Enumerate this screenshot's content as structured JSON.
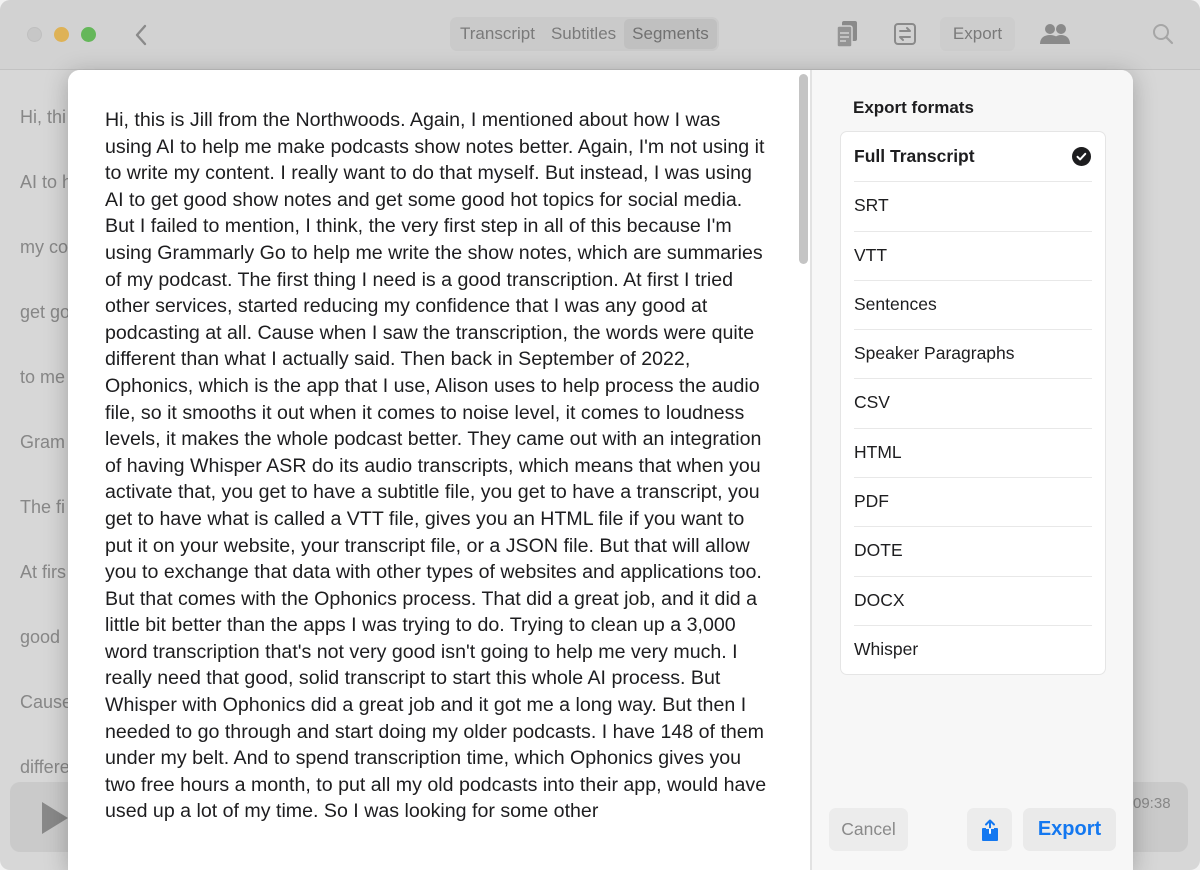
{
  "toolbar": {
    "tabs": [
      {
        "label": "Transcript",
        "active": false
      },
      {
        "label": "Subtitles",
        "active": false
      },
      {
        "label": "Segments",
        "active": true
      }
    ],
    "export_label": "Export",
    "icons": [
      "chevron-left-icon",
      "copy-icon",
      "convert-icon",
      "people-icon",
      "search-icon"
    ]
  },
  "background": {
    "lines": [
      "Hi, thi",
      "AI to h",
      "my co",
      "get go",
      "to me",
      "Gram",
      "The fi",
      "At firs",
      "good",
      "Cause",
      "differe"
    ],
    "time_fragment": "09:38"
  },
  "transcript": {
    "text": "Hi, this is Jill from the Northwoods. Again, I mentioned about how I was using AI to help me make podcasts show notes better. Again, I'm not using it to write my content. I really want to do that myself. But instead, I was using AI to get good show notes and get some good hot topics for social media. But I failed to mention, I think, the very first step in all of this because I'm using Grammarly Go to help me write the show notes, which are summaries of my podcast. The first thing I need is a good transcription. At first I tried other services, started reducing my confidence that I was any good at podcasting at all. Cause when I saw the transcription, the words were quite different than what I actually said. Then back in September of 2022, Ophonics, which is the app that I use, Alison uses to help process the audio file, so it smooths it out when it comes to noise level, it comes to loudness levels, it makes the whole podcast better. They came out with an integration of having Whisper ASR do its audio transcripts, which means that when you activate that, you get to have a subtitle file, you get to have a transcript, you get to have what is called a VTT file, gives you an HTML file if you want to put it on your website, your transcript file, or a JSON file. But that will allow you to exchange that data with other types of websites and applications too. But that comes with the Ophonics process. That did a great job, and it did a little bit better than the apps I was trying to do. Trying to clean up a 3,000 word transcription that's not very good isn't going to help me very much. I really need that good, solid transcript to start this whole AI process. But Whisper with Ophonics did a great job and it got me a long way. But then I needed to go through and start doing my older podcasts. I have 148 of them under my belt. And to spend transcription time, which Ophonics gives you two free hours a month, to put all my old podcasts into their app, would have used up a lot of my time. So I was looking for some other"
  },
  "export_panel": {
    "title": "Export formats",
    "formats": [
      {
        "label": "Full Transcript",
        "selected": true
      },
      {
        "label": "SRT",
        "selected": false
      },
      {
        "label": "VTT",
        "selected": false
      },
      {
        "label": "Sentences",
        "selected": false
      },
      {
        "label": "Speaker Paragraphs",
        "selected": false
      },
      {
        "label": "CSV",
        "selected": false
      },
      {
        "label": "HTML",
        "selected": false
      },
      {
        "label": "PDF",
        "selected": false
      },
      {
        "label": "DOTE",
        "selected": false
      },
      {
        "label": "DOCX",
        "selected": false
      },
      {
        "label": "Whisper",
        "selected": false
      }
    ],
    "cancel_label": "Cancel",
    "export_label": "Export",
    "accent_color": "#1478f0"
  }
}
